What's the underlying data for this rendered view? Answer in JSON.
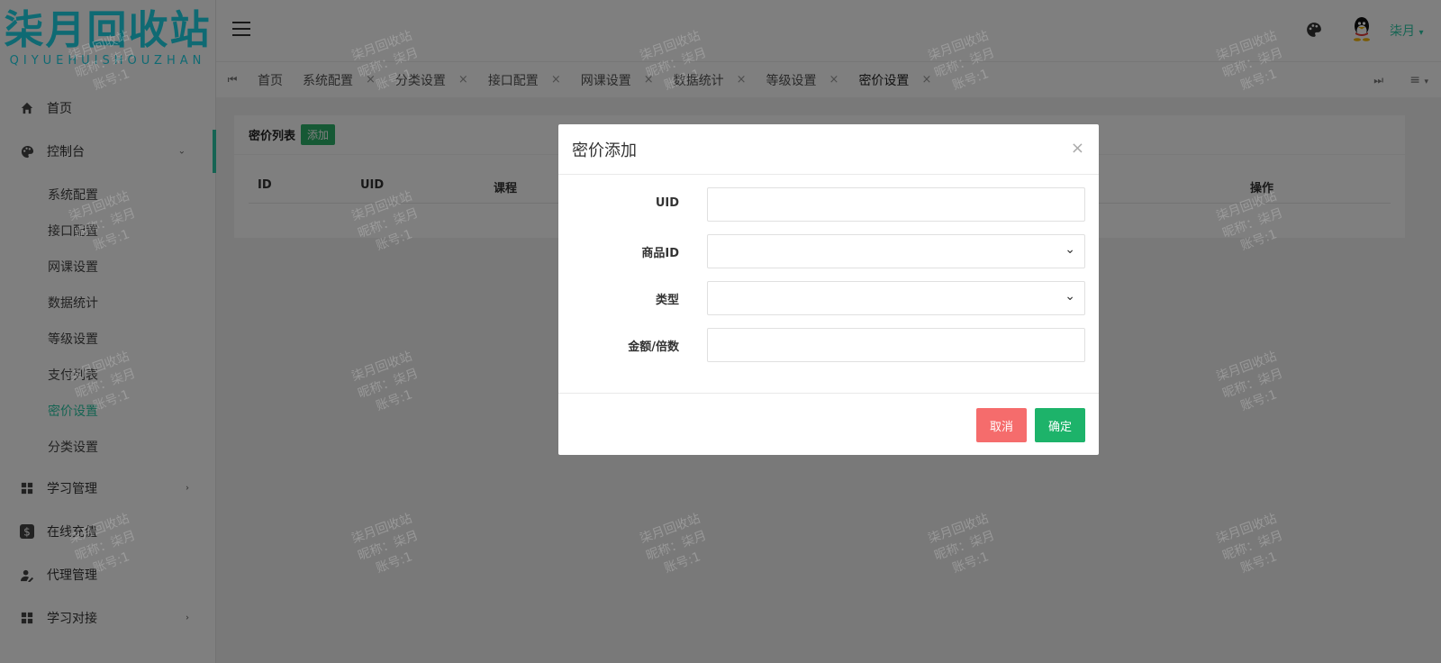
{
  "logo": {
    "text": "柒月回收站",
    "sub": "QIYUEHUISHOUZHAN"
  },
  "sidebar": {
    "items": [
      {
        "label": "首页",
        "icon": "home-icon"
      },
      {
        "label": "控制台",
        "icon": "palette-icon",
        "expanded": true
      },
      {
        "label": "学习管理",
        "icon": "grid-icon"
      },
      {
        "label": "在线充值",
        "icon": "dollar-icon"
      },
      {
        "label": "代理管理",
        "icon": "user-edit-icon"
      },
      {
        "label": "学习对接",
        "icon": "grid-icon"
      }
    ],
    "submenu": [
      "系统配置",
      "接口配置",
      "网课设置",
      "数据统计",
      "等级设置",
      "支付列表",
      "密价设置",
      "分类设置"
    ],
    "current_sub": "密价设置"
  },
  "topbar": {
    "user": "柒月"
  },
  "tabs": [
    "首页",
    "系统配置",
    "分类设置",
    "接口配置",
    "网课设置",
    "数据统计",
    "等级设置",
    "密价设置"
  ],
  "card": {
    "title": "密价列表",
    "add_label": "添加",
    "columns": [
      "ID",
      "UID",
      "课程",
      "操作"
    ]
  },
  "dialog": {
    "title": "密价添加",
    "fields": [
      {
        "label": "UID",
        "type": "input",
        "value": ""
      },
      {
        "label": "商品ID",
        "type": "select",
        "value": ""
      },
      {
        "label": "类型",
        "type": "select",
        "value": ""
      },
      {
        "label": "金额/倍数",
        "type": "input",
        "value": ""
      }
    ],
    "cancel_label": "取消",
    "ok_label": "确定"
  },
  "watermark": {
    "line1": "柒月回收站",
    "line2": "昵称：柒月",
    "line3": "账号:1"
  },
  "colors": {
    "accent": "#2cc9a6",
    "logo": "#1fd5e6",
    "add": "#2cb36b",
    "cancel": "#f56c6c",
    "ok": "#1db36a"
  }
}
